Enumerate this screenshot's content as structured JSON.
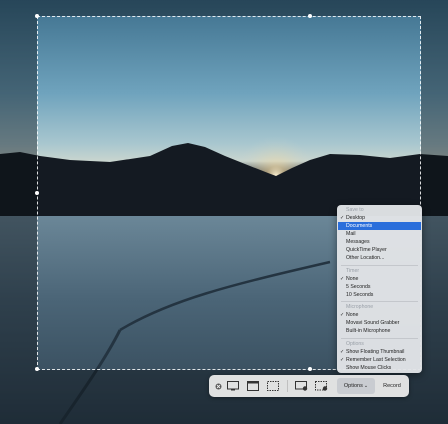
{
  "menu": {
    "save_to": {
      "header": "Save to",
      "items": [
        {
          "label": "Desktop",
          "checked": true
        },
        {
          "label": "Documents",
          "highlighted": true
        },
        {
          "label": "Mail"
        },
        {
          "label": "Messages"
        },
        {
          "label": "QuickTime Player"
        },
        {
          "label": "Other Location..."
        }
      ]
    },
    "timer": {
      "header": "Timer",
      "items": [
        {
          "label": "None",
          "checked": true
        },
        {
          "label": "5 Seconds"
        },
        {
          "label": "10 Seconds"
        }
      ]
    },
    "microphone": {
      "header": "Microphone",
      "items": [
        {
          "label": "None",
          "checked": true
        },
        {
          "label": "Movavi Sound Grabber"
        },
        {
          "label": "Built-in Microphone"
        }
      ]
    },
    "options": {
      "header": "Options",
      "items": [
        {
          "label": "Show Floating Thumbnail",
          "checked": true
        },
        {
          "label": "Remember Last Selection",
          "checked": true
        },
        {
          "label": "Show Mouse Clicks"
        }
      ]
    },
    "check_glyph": "✓"
  },
  "toolbar": {
    "options_label": "Options",
    "options_chevron": "⌄",
    "record_label": "Record",
    "icons": [
      "close-icon",
      "capture-entire-screen-icon",
      "capture-window-icon",
      "capture-selection-icon",
      "record-entire-screen-icon",
      "record-selection-icon"
    ]
  },
  "colors": {
    "menu_highlight": "#2a6edb",
    "accent": "#2a6edb"
  }
}
